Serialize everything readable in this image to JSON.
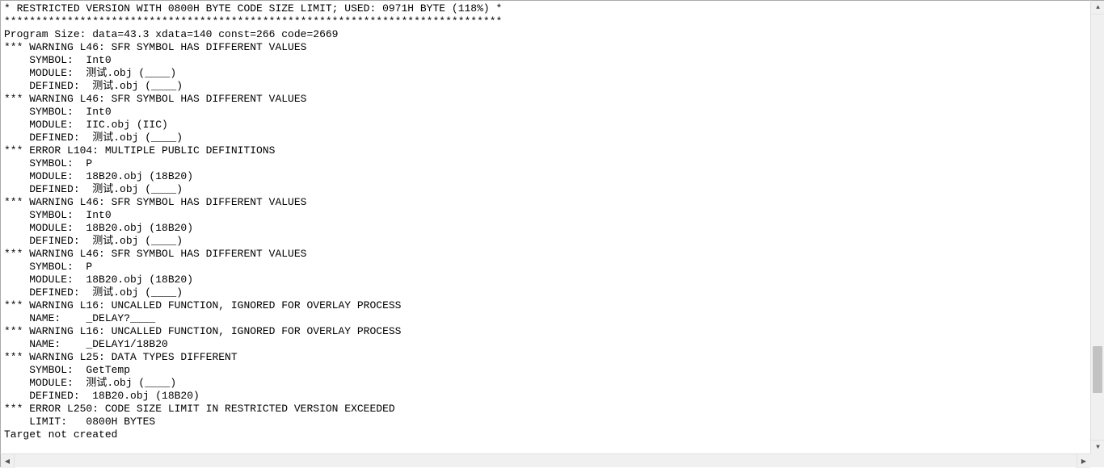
{
  "output": {
    "lines": [
      "* RESTRICTED VERSION WITH 0800H BYTE CODE SIZE LIMIT; USED: 0971H BYTE (118%) *",
      "*******************************************************************************",
      "Program Size: data=43.3 xdata=140 const=266 code=2669",
      "*** WARNING L46: SFR SYMBOL HAS DIFFERENT VALUES",
      "    SYMBOL:  Int0",
      "    MODULE:  测试.obj (____)",
      "    DEFINED:  测试.obj (____)",
      "*** WARNING L46: SFR SYMBOL HAS DIFFERENT VALUES",
      "    SYMBOL:  Int0",
      "    MODULE:  IIC.obj (IIC)",
      "    DEFINED:  测试.obj (____)",
      "*** ERROR L104: MULTIPLE PUBLIC DEFINITIONS",
      "    SYMBOL:  P",
      "    MODULE:  18B20.obj (18B20)",
      "    DEFINED:  测试.obj (____)",
      "*** WARNING L46: SFR SYMBOL HAS DIFFERENT VALUES",
      "    SYMBOL:  Int0",
      "    MODULE:  18B20.obj (18B20)",
      "    DEFINED:  测试.obj (____)",
      "*** WARNING L46: SFR SYMBOL HAS DIFFERENT VALUES",
      "    SYMBOL:  P",
      "    MODULE:  18B20.obj (18B20)",
      "    DEFINED:  测试.obj (____)",
      "*** WARNING L16: UNCALLED FUNCTION, IGNORED FOR OVERLAY PROCESS",
      "    NAME:    _DELAY?____",
      "*** WARNING L16: UNCALLED FUNCTION, IGNORED FOR OVERLAY PROCESS",
      "    NAME:    _DELAY1/18B20",
      "*** WARNING L25: DATA TYPES DIFFERENT",
      "    SYMBOL:  GetTemp",
      "    MODULE:  测试.obj (____)",
      "    DEFINED:  18B20.obj (18B20)",
      "*** ERROR L250: CODE SIZE LIMIT IN RESTRICTED VERSION EXCEEDED",
      "    LIMIT:   0800H BYTES",
      "Target not created"
    ]
  },
  "scroll": {
    "up_glyph": "▲",
    "down_glyph": "▼",
    "left_glyph": "◀",
    "right_glyph": "▶"
  }
}
